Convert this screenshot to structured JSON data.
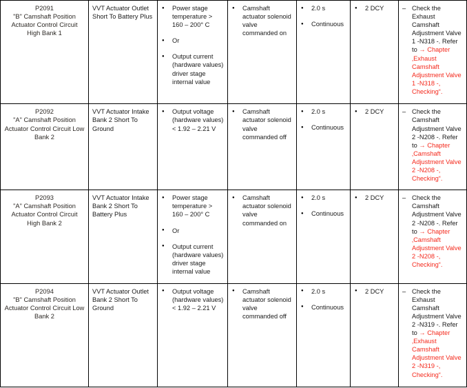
{
  "document": {
    "type": "dtc-table",
    "colors": {
      "text": "#1a1a1a",
      "code_text": "#2e2a26",
      "link_red": "#f4291c",
      "border": "#000000"
    }
  },
  "columns": [
    {
      "key": "code",
      "name": "fault-code"
    },
    {
      "key": "description",
      "name": "fault-description"
    },
    {
      "key": "conditions",
      "name": "detection-conditions"
    },
    {
      "key": "requirements",
      "name": "test-requirements"
    },
    {
      "key": "timing",
      "name": "detection-time"
    },
    {
      "key": "healing",
      "name": "healing-cycles"
    },
    {
      "key": "action",
      "name": "corrective-action"
    }
  ],
  "rows": [
    {
      "code": {
        "id": "P2091",
        "description": "\"B\" Camshaft Position Actuator Control Circuit High Bank 1"
      },
      "fault_text": "VVT Actuator Outlet Short To Battery Plus",
      "conditions": [
        "Power stage temperature > 160 – 200° C",
        "Or",
        "Output current (hardware values) driver stage internal value"
      ],
      "requirements": [
        "Camshaft actuator solenoid valve commanded on"
      ],
      "timing": [
        "2.0 s",
        "Continuous"
      ],
      "healing": [
        "2 DCY"
      ],
      "action": {
        "lead": "Check the Exhaust Camshaft Adjustment Valve 1 -N318 -. Refer to ",
        "arrow": "→ ",
        "link": "Chapter ‚Exhaust Camshaft Adjustment Valve 1 -N318 -, Checking“."
      }
    },
    {
      "code": {
        "id": "P2092",
        "description": "\"A\" Camshaft Position Actuator Control Circuit Low Bank 2"
      },
      "fault_text": "VVT Actuator Intake Bank 2 Short To Ground",
      "conditions": [
        "Output voltage (hardware values) < 1.92 – 2.21 V"
      ],
      "requirements": [
        "Camshaft actuator solenoid valve commanded off"
      ],
      "timing": [
        "2.0 s",
        "Continuous"
      ],
      "healing": [
        "2 DCY"
      ],
      "action": {
        "lead": "Check the Camshaft Adjustment Valve 2 -N208 -. Refer to ",
        "arrow": "→ ",
        "link": "Chapter ‚Camshaft Adjustment Valve 2 -N208 -, Checking“."
      }
    },
    {
      "code": {
        "id": "P2093",
        "description": "\"A\" Camshaft Position Actuator Control Circuit High Bank 2"
      },
      "fault_text": "VVT Actuator Intake Bank 2 Short To Battery Plus",
      "conditions": [
        "Power stage temperature > 160 – 200° C",
        "Or",
        "Output current (hardware values) driver stage internal value"
      ],
      "requirements": [
        "Camshaft actuator solenoid valve commanded on"
      ],
      "timing": [
        "2.0 s",
        "Continuous"
      ],
      "healing": [
        "2 DCY"
      ],
      "action": {
        "lead": "Check the Camshaft Adjustment Valve 2 -N208 -. Refer to ",
        "arrow": "→ ",
        "link": "Chapter ‚Camshaft Adjustment Valve 2 -N208 -, Checking“."
      }
    },
    {
      "code": {
        "id": "P2094",
        "description": "\"B\" Camshaft Position Actuator Control Circuit Low Bank 2"
      },
      "fault_text": "VVT Actuator Outlet Bank 2 Short To Ground",
      "conditions": [
        "Output voltage (hardware values) < 1.92 – 2.21 V"
      ],
      "requirements": [
        "Camshaft actuator solenoid valve commanded off"
      ],
      "timing": [
        "2.0 s",
        "Continuous"
      ],
      "healing": [
        "2 DCY"
      ],
      "action": {
        "lead": "Check the Exhaust Camshaft Adjustment Valve 2 -N319 -. Refer to ",
        "arrow": "→ ",
        "link": "Chapter ‚Exhaust Camshaft Adjustment Valve 2 -N319 -, Checking“."
      }
    }
  ]
}
